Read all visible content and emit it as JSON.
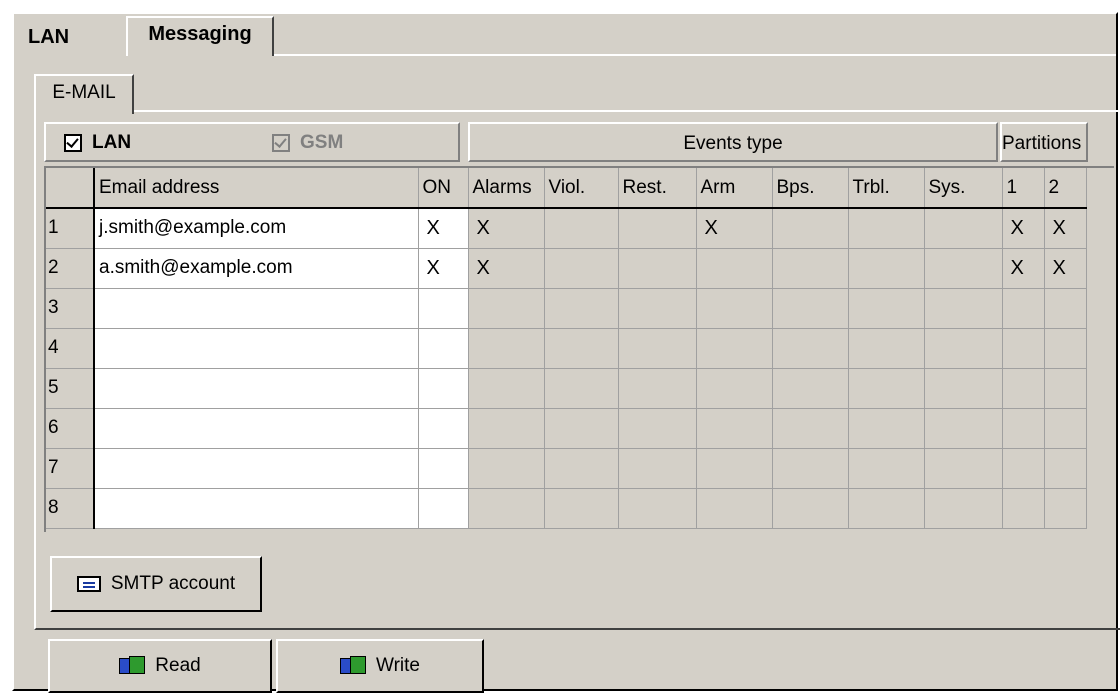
{
  "tabs": {
    "lan": "LAN",
    "messaging": "Messaging"
  },
  "subtab": {
    "email": "E-MAIL"
  },
  "channels": {
    "lan": {
      "label": "LAN",
      "checked": true,
      "enabled": true
    },
    "gsm": {
      "label": "GSM",
      "checked": true,
      "enabled": false
    }
  },
  "headers": {
    "events_type": "Events type",
    "partitions": "Partitions",
    "columns": [
      "Email address",
      "ON",
      "Alarms",
      "Viol.",
      "Rest.",
      "Arm",
      "Bps.",
      "Trbl.",
      "Sys.",
      "1",
      "2"
    ]
  },
  "rows": [
    {
      "num": "1",
      "email": "j.smith@example.com",
      "on": "X",
      "alarms": "X",
      "viol": "",
      "rest": "",
      "arm": "X",
      "bps": "",
      "trbl": "",
      "sys": "",
      "p1": "X",
      "p2": "X"
    },
    {
      "num": "2",
      "email": "a.smith@example.com",
      "on": "X",
      "alarms": "X",
      "viol": "",
      "rest": "",
      "arm": "",
      "bps": "",
      "trbl": "",
      "sys": "",
      "p1": "X",
      "p2": "X"
    },
    {
      "num": "3",
      "email": "",
      "on": "",
      "alarms": "",
      "viol": "",
      "rest": "",
      "arm": "",
      "bps": "",
      "trbl": "",
      "sys": "",
      "p1": "",
      "p2": ""
    },
    {
      "num": "4",
      "email": "",
      "on": "",
      "alarms": "",
      "viol": "",
      "rest": "",
      "arm": "",
      "bps": "",
      "trbl": "",
      "sys": "",
      "p1": "",
      "p2": ""
    },
    {
      "num": "5",
      "email": "",
      "on": "",
      "alarms": "",
      "viol": "",
      "rest": "",
      "arm": "",
      "bps": "",
      "trbl": "",
      "sys": "",
      "p1": "",
      "p2": ""
    },
    {
      "num": "6",
      "email": "",
      "on": "",
      "alarms": "",
      "viol": "",
      "rest": "",
      "arm": "",
      "bps": "",
      "trbl": "",
      "sys": "",
      "p1": "",
      "p2": ""
    },
    {
      "num": "7",
      "email": "",
      "on": "",
      "alarms": "",
      "viol": "",
      "rest": "",
      "arm": "",
      "bps": "",
      "trbl": "",
      "sys": "",
      "p1": "",
      "p2": ""
    },
    {
      "num": "8",
      "email": "",
      "on": "",
      "alarms": "",
      "viol": "",
      "rest": "",
      "arm": "",
      "bps": "",
      "trbl": "",
      "sys": "",
      "p1": "",
      "p2": ""
    }
  ],
  "buttons": {
    "smtp": "SMTP account",
    "read": "Read",
    "write": "Write"
  },
  "icons": {
    "smtp": "envelope-icon",
    "read": "read-disk-icon",
    "write": "write-disk-icon"
  },
  "colors": {
    "face": "#d4d0c8",
    "highlight": "#ffffff",
    "shadow": "#808080"
  }
}
